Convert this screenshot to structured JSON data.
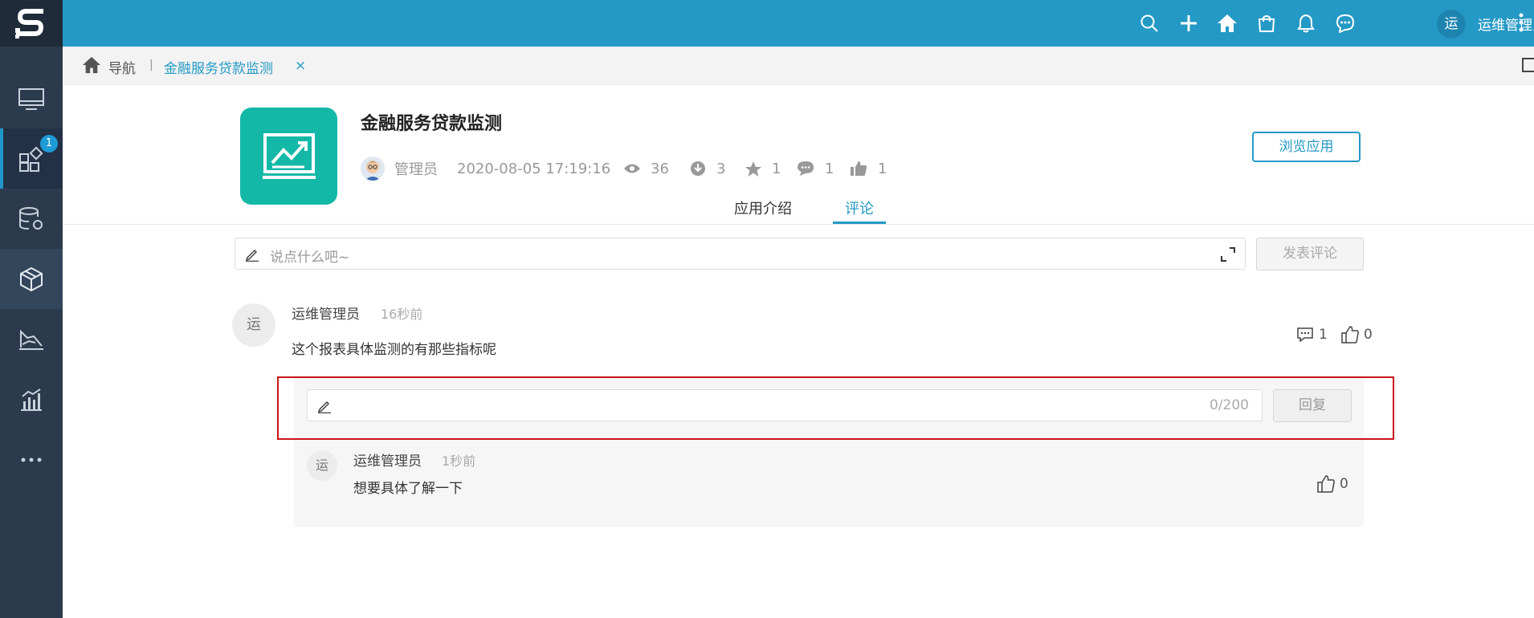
{
  "rail": {
    "badge": "1"
  },
  "topbar": {
    "user_avatar": "运",
    "user_name": "运维管理员"
  },
  "breadcrumb": {
    "nav_label": "导航",
    "separator": "|",
    "tab_label": "金融服务贷款监测",
    "tab_close": "×"
  },
  "app": {
    "title": "金融服务贷款监测",
    "author": "管理员",
    "date": "2020-08-05 17:19:16",
    "views": "36",
    "downloads": "3",
    "favorites": "1",
    "comments": "1",
    "likes": "1",
    "browse_button": "浏览应用",
    "icon_color": "#14b8a6"
  },
  "tabs": {
    "intro": "应用介绍",
    "comment": "评论"
  },
  "comment_box": {
    "placeholder": "说点什么吧~",
    "post_button": "发表评论"
  },
  "comment": {
    "avatar": "运",
    "author": "运维管理员",
    "time": "16秒前",
    "text": "这个报表具体监测的有那些指标呢",
    "reply_count": "1",
    "like_count": "0"
  },
  "reply_box": {
    "counter": "0/200",
    "reply_button": "回复"
  },
  "reply": {
    "avatar": "运",
    "author": "运维管理员",
    "time": "1秒前",
    "text": "想要具体了解一下",
    "like_count": "0"
  },
  "colors": {
    "topbar": "#2599c6",
    "rail": "#2b3a4d",
    "accent": "#2599c6",
    "highlight": "#c8151b"
  }
}
